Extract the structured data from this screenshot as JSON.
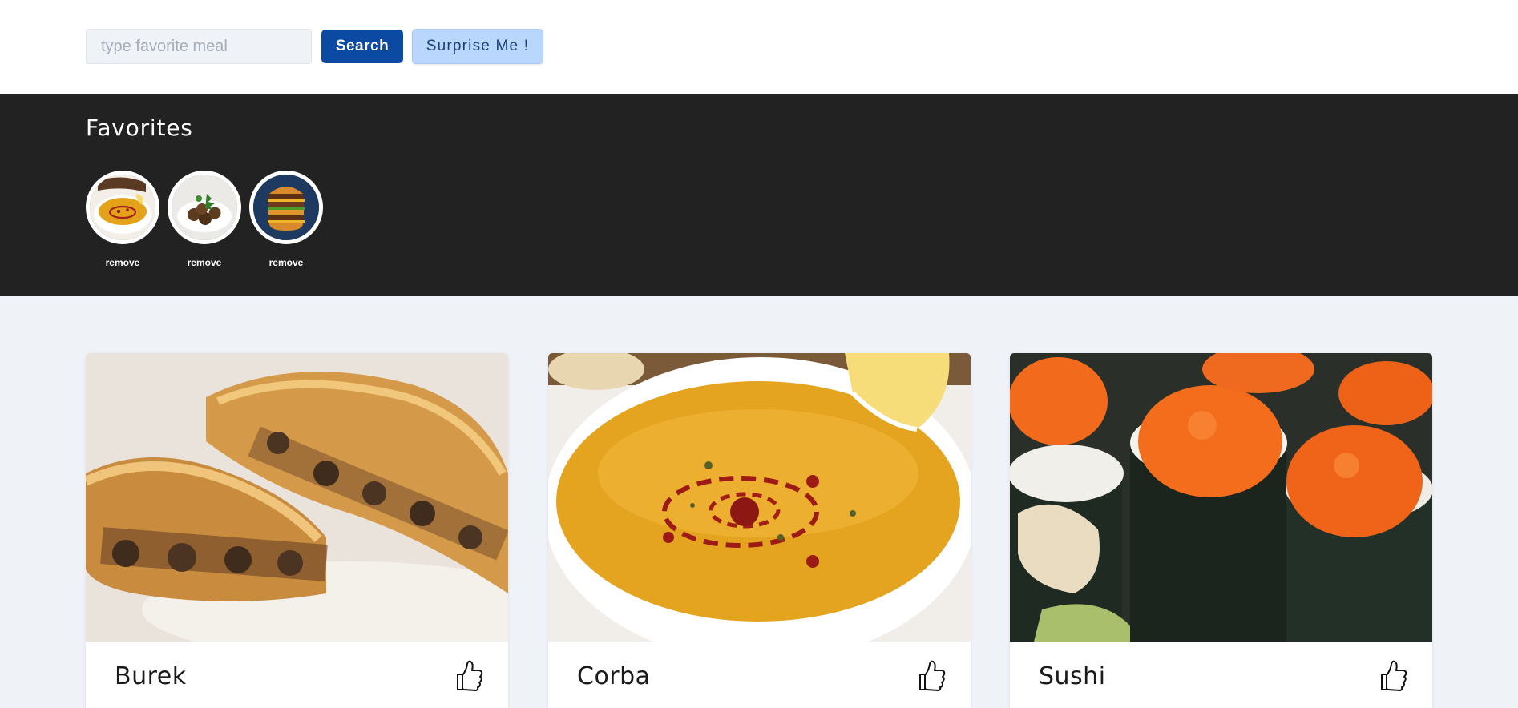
{
  "search": {
    "placeholder": "type favorite meal",
    "value": "",
    "search_label": "Search",
    "surprise_label": "Surprise Me !"
  },
  "favorites": {
    "title": "Favorites",
    "items": [
      {
        "meal": "soup-thumbnail",
        "remove_label": "remove"
      },
      {
        "meal": "meatballs-thumbnail",
        "remove_label": "remove"
      },
      {
        "meal": "burger-thumbnail",
        "remove_label": "remove"
      }
    ]
  },
  "meals": [
    {
      "name": "Burek",
      "image": "burek-photo",
      "like_icon": "thumbs-up-icon"
    },
    {
      "name": "Corba",
      "image": "corba-soup-photo",
      "like_icon": "thumbs-up-icon"
    },
    {
      "name": "Sushi",
      "image": "sushi-photo",
      "like_icon": "thumbs-up-icon"
    }
  ],
  "colors": {
    "primary": "#0a4aa3",
    "secondary": "#b9d6fc",
    "dark_band": "#222222",
    "page_bg": "#eff3f8"
  }
}
